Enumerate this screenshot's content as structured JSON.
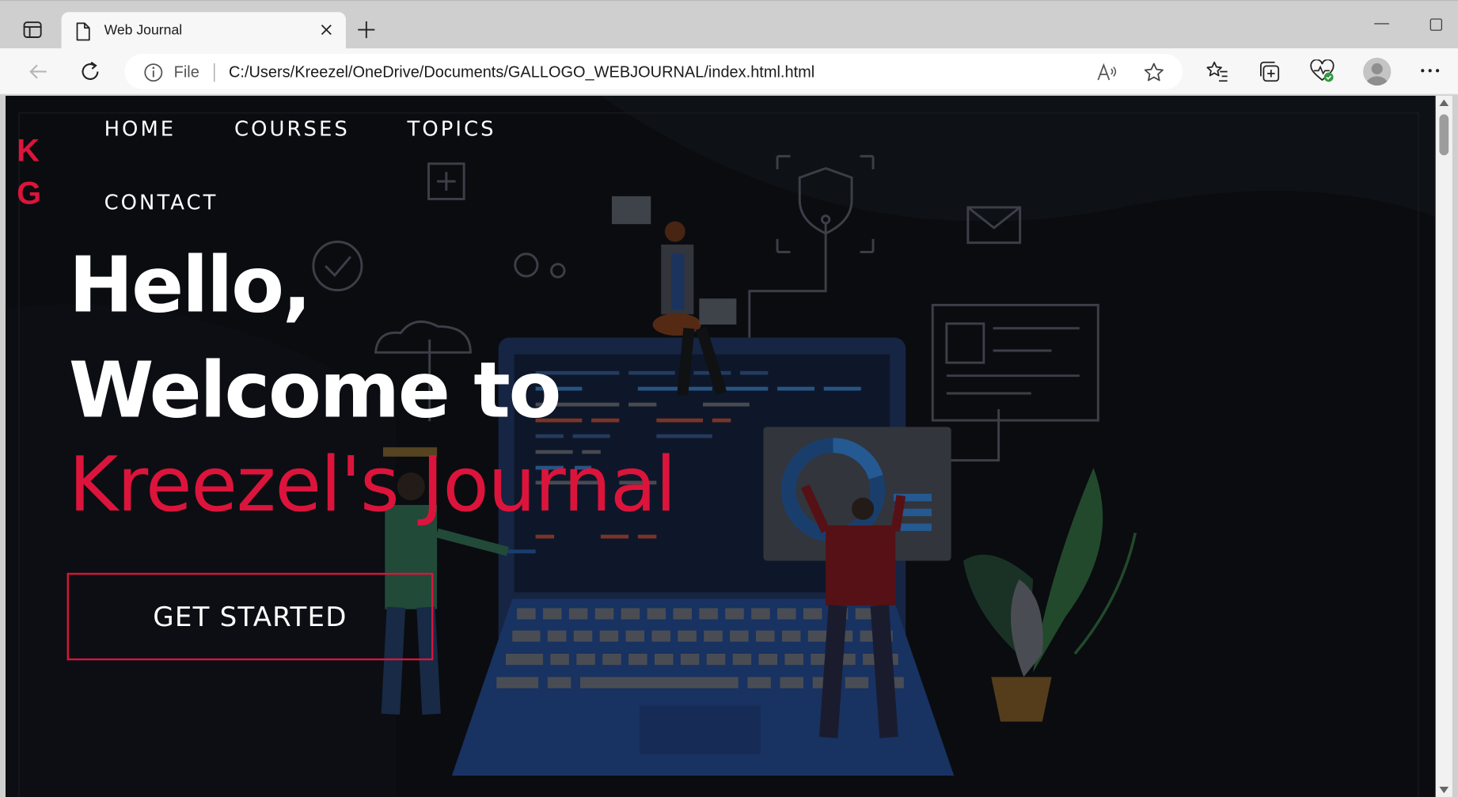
{
  "browser": {
    "tab_title": "Web Journal",
    "address_scheme": "File",
    "url": "C:/Users/Kreezel/OneDrive/Documents/GALLOGO_WEBJOURNAL/index.html.html"
  },
  "page": {
    "logo_line1": "K",
    "logo_line2": "G",
    "nav": {
      "home": "HOME",
      "courses": "COURSES",
      "topics": "TOPICS",
      "contact": "CONTACT"
    },
    "hero": {
      "line1": "Hello,",
      "line2": "Welcome to",
      "line3": "Kreezel's Journal",
      "cta": "GET STARTED"
    }
  },
  "colors": {
    "accent": "#dc143c",
    "page_background": "#0b0c10",
    "hero_text": "#ffffff"
  },
  "icons": [
    "sidebar-toggle-icon",
    "document-icon",
    "close-icon",
    "plus-icon",
    "back-arrow-icon",
    "refresh-icon",
    "info-icon",
    "read-aloud-icon",
    "star-icon",
    "favorites-icon",
    "collections-icon",
    "browser-essentials-icon",
    "profile-icon",
    "more-icon"
  ]
}
